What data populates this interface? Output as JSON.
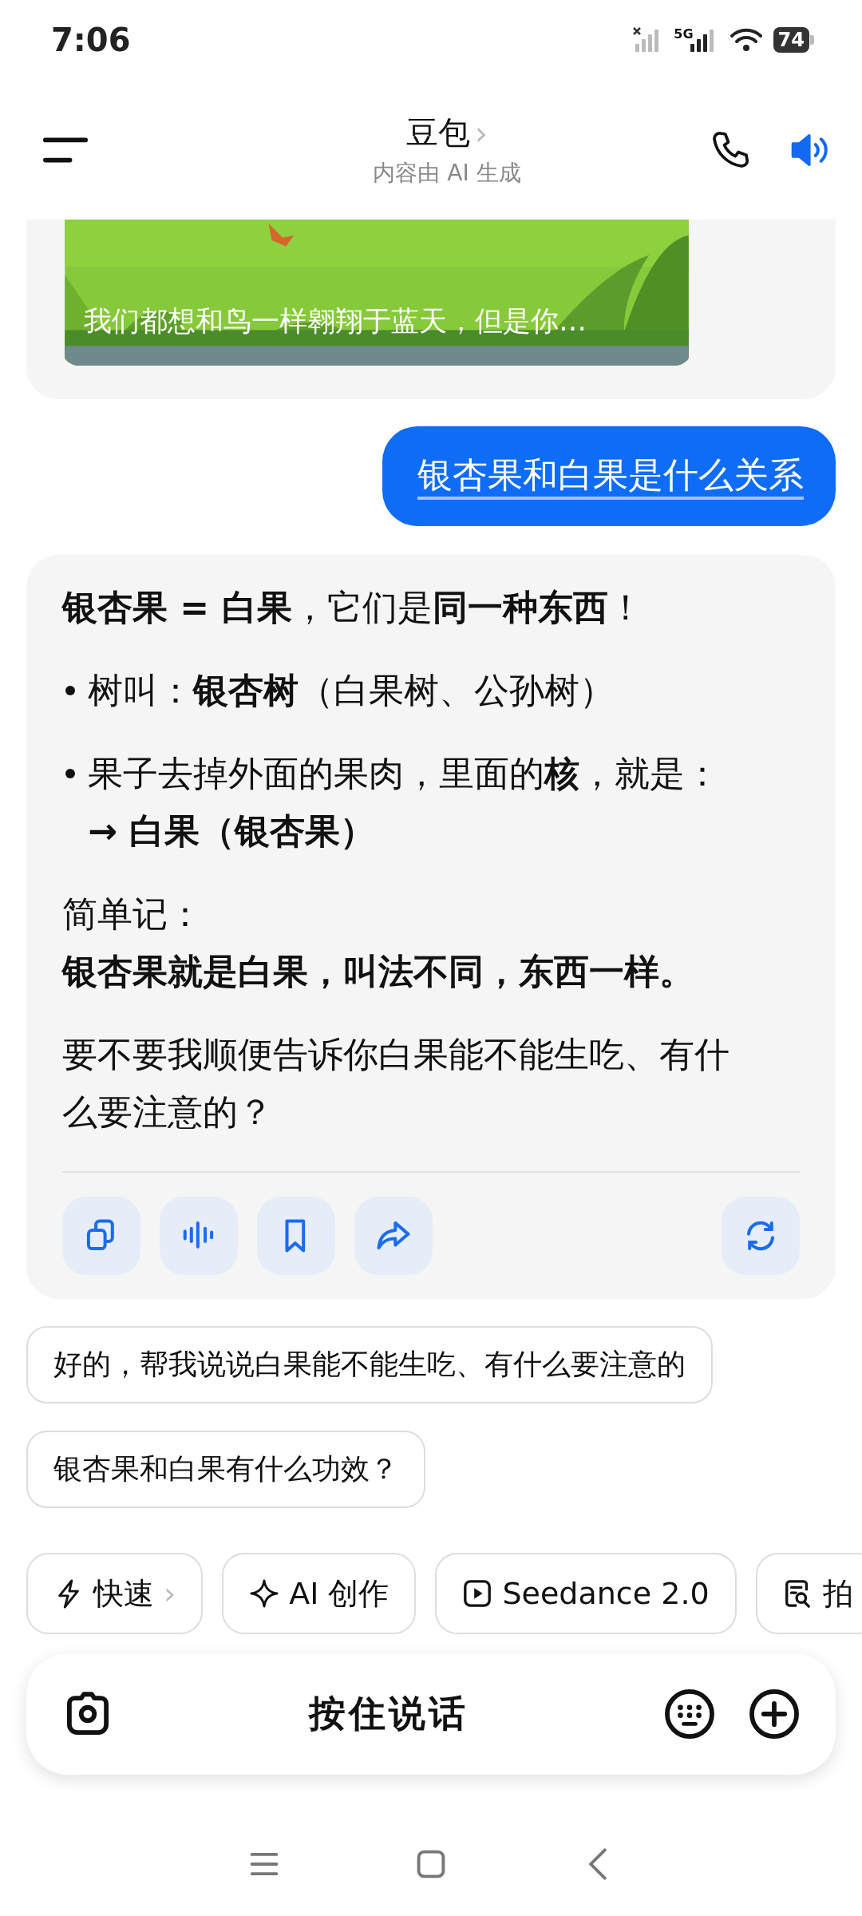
{
  "status_bar": {
    "time": "7:06",
    "network": "5G",
    "battery": "74"
  },
  "header": {
    "title": "豆包",
    "chevron": "›",
    "subtitle": "内容由 AI 生成"
  },
  "video_card": {
    "kind": "picture",
    "caption": "我们都想和鸟一样翱翔于蓝天，但是你…"
  },
  "user_message": {
    "text": "银杏果和白果是什么关系"
  },
  "answer": {
    "paragraphs": [
      {
        "kind": "text",
        "lines": [
          "**银杏果 = 白果**，它们是**同一种东西**！"
        ]
      },
      {
        "kind": "bullet",
        "lines": [
          "树叫：**银杏树**（白果树、公孙树）"
        ]
      },
      {
        "kind": "bullet",
        "lines": [
          "果子去掉外面的果肉，里面的**核**，就是：",
          "**→ 白果（银杏果）**"
        ]
      },
      {
        "kind": "text",
        "lines": [
          "简单记：",
          "**银杏果就是白果，叫法不同，东西一样。**"
        ]
      },
      {
        "kind": "text",
        "lines": [
          "要不要我顺便告诉你白果能不能生吃、有什么要注意的？"
        ]
      }
    ],
    "actions": [
      {
        "kind": "copy"
      },
      {
        "kind": "voice"
      },
      {
        "kind": "bookmark"
      },
      {
        "kind": "share"
      },
      {
        "kind": "regenerate"
      }
    ]
  },
  "suggestions": [
    "好的，帮我说说白果能不能生吃、有什么要注意的",
    "银杏果和白果有什么功效？"
  ],
  "chips": [
    {
      "kind": "bolt",
      "label": "快速",
      "chevron": "›"
    },
    {
      "kind": "sparkle",
      "label": "AI 创作"
    },
    {
      "kind": "play",
      "label": "Seedance 2.0"
    },
    {
      "kind": "search-doc",
      "label": "拍"
    }
  ],
  "input_bar": {
    "label": "按住说话"
  }
}
